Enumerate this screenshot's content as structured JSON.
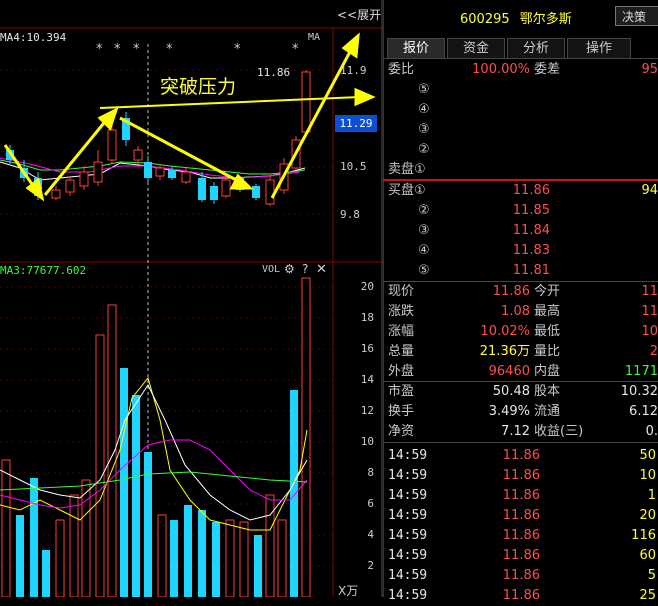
{
  "chart": {
    "ma_label": "MA4:10.394",
    "expand_label": "<<展开",
    "stars": [
      "*",
      "*",
      "*",
      "*",
      "*",
      "*"
    ],
    "ma_tag": "MA",
    "price_high_label": "11.86",
    "annotation": "突破压力",
    "price_axis": [
      "11.9",
      "11.29",
      "10.5",
      "9.8"
    ],
    "vol_label": "MA3:77677.602",
    "vol_tag": "VOL",
    "vol_axis": [
      "20",
      "18",
      "16",
      "14",
      "12",
      "10",
      "8",
      "6",
      "4",
      "2"
    ],
    "vol_unit": "X万",
    "colors": {
      "up": "#ff3b3b",
      "down": "#1fd5ff",
      "ma1": "#ffffff",
      "ma2": "#ffff00",
      "ma3": "#ff00ff",
      "ma4": "#33ff33",
      "arrow": "#ffff00",
      "grid": "#8b0000"
    }
  },
  "header": {
    "code": "600295",
    "name": "鄂尔多斯",
    "decision_button": "决策"
  },
  "tabs": [
    "报价",
    "资金",
    "分析",
    "操作"
  ],
  "order_ratio": {
    "label": "委比",
    "value": "100.00%",
    "diff_label": "委差",
    "diff_value": "95"
  },
  "sell_levels": [
    {
      "label": "⑤"
    },
    {
      "label": "④"
    },
    {
      "label": "③"
    },
    {
      "label": "②"
    },
    {
      "label": "卖盘①"
    }
  ],
  "buy_levels": [
    {
      "label": "买盘①",
      "price": "11.86",
      "qty": "94"
    },
    {
      "label": "②",
      "price": "11.85",
      "qty": ""
    },
    {
      "label": "③",
      "price": "11.84",
      "qty": ""
    },
    {
      "label": "④",
      "price": "11.83",
      "qty": ""
    },
    {
      "label": "⑤",
      "price": "11.81",
      "qty": ""
    }
  ],
  "stats": [
    {
      "l1": "现价",
      "v1": "11.86",
      "l2": "今开",
      "v2": "11",
      "c1": "red"
    },
    {
      "l1": "涨跌",
      "v1": "1.08",
      "l2": "最高",
      "v2": "11",
      "c1": "red"
    },
    {
      "l1": "涨幅",
      "v1": "10.02%",
      "l2": "最低",
      "v2": "10",
      "c1": "red"
    },
    {
      "l1": "总量",
      "v1": "21.36万",
      "l2": "量比",
      "v2": "2",
      "c1": "yellow"
    },
    {
      "l1": "外盘",
      "v1": "96460",
      "l2": "内盘",
      "v2": "1171",
      "c1": "red"
    }
  ],
  "fundamentals": [
    {
      "l1": "市盈",
      "v1": "50.48",
      "l2": "股本",
      "v2": "10.32"
    },
    {
      "l1": "换手",
      "v1": "3.49%",
      "l2": "流通",
      "v2": "6.12"
    },
    {
      "l1": "净资",
      "v1": "7.12",
      "l2": "收益(三)",
      "v2": "0."
    }
  ],
  "ticks": [
    {
      "time": "14:59",
      "price": "11.86",
      "vol": "50"
    },
    {
      "time": "14:59",
      "price": "11.86",
      "vol": "10"
    },
    {
      "time": "14:59",
      "price": "11.86",
      "vol": "1"
    },
    {
      "time": "14:59",
      "price": "11.86",
      "vol": "20"
    },
    {
      "time": "14:59",
      "price": "11.86",
      "vol": "116"
    },
    {
      "time": "14:59",
      "price": "11.86",
      "vol": "60"
    },
    {
      "time": "14:59",
      "price": "11.86",
      "vol": "5"
    },
    {
      "time": "14:59",
      "price": "11.86",
      "vol": "25"
    }
  ]
}
